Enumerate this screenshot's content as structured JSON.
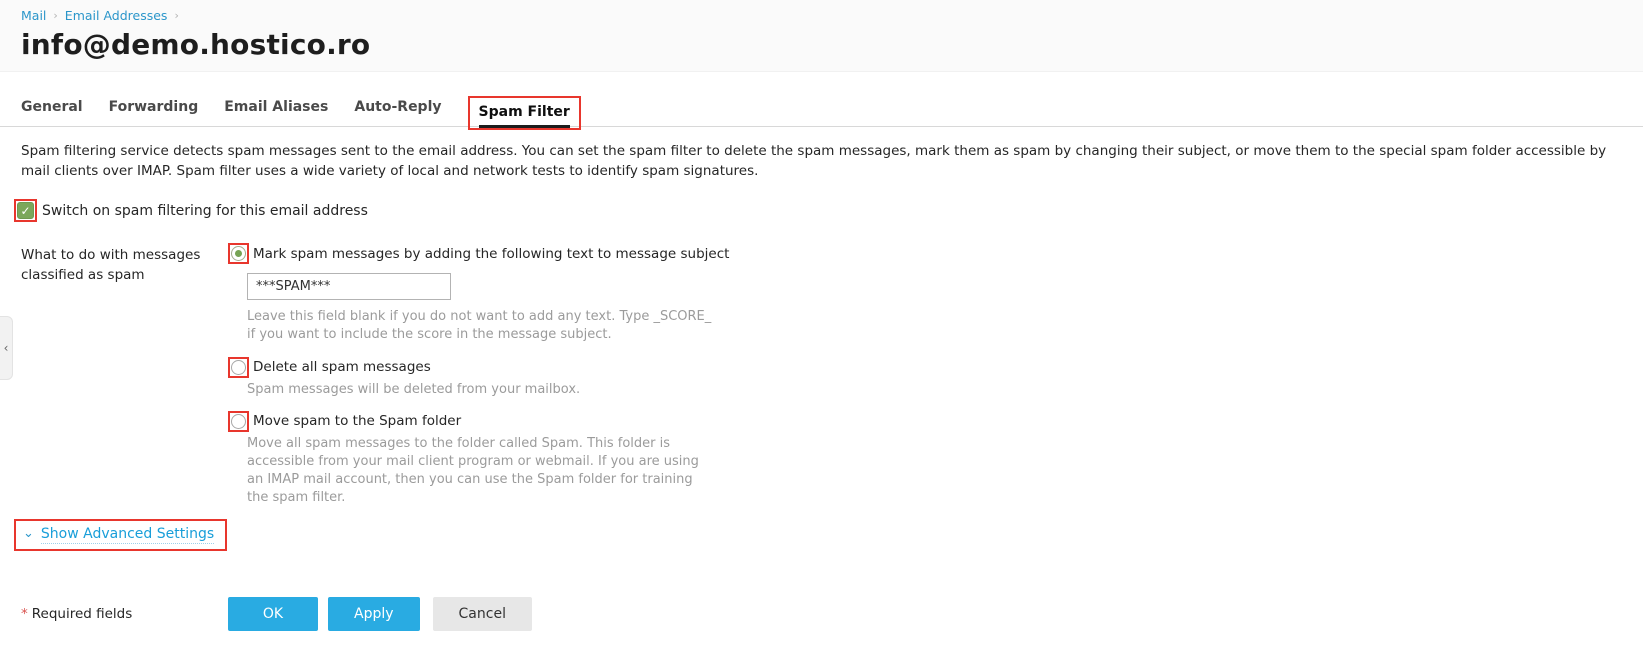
{
  "page_title": "info@demo.hostico.ro",
  "breadcrumb": {
    "separator": "›",
    "items": [
      {
        "label": "Mail"
      },
      {
        "label": "Email Addresses"
      }
    ]
  },
  "tabs": {
    "active": "Spam Filter",
    "items": [
      {
        "label": "General"
      },
      {
        "label": "Forwarding"
      },
      {
        "label": "Email Aliases"
      },
      {
        "label": "Auto-Reply"
      },
      {
        "label": "Spam Filter"
      }
    ]
  },
  "description": "Spam filtering service detects spam messages sent to the email address. You can set the spam filter to delete the spam messages, mark them as spam by changing their subject, or move them to the special spam folder accessible by mail clients over IMAP. Spam filter uses a wide variety of local and network tests to identify spam signatures.",
  "spam_switch": {
    "label": "Switch on spam filtering for this email address",
    "checked": true
  },
  "classification": {
    "label": "What to do with messages classified as spam",
    "options": [
      {
        "label": "Mark spam messages by adding the following text to message subject",
        "selected": true,
        "input_value": "***SPAM***",
        "help": "Leave this field blank if you do not want to add any text. Type _SCORE_ if you want to include the score in the message subject."
      },
      {
        "label": "Delete all spam messages",
        "selected": false,
        "help": "Spam messages will be deleted from your mailbox."
      },
      {
        "label": "Move spam to the Spam folder",
        "selected": false,
        "help": "Move all spam messages to the folder called Spam. This folder is accessible from your mail client program or webmail. If you are using an IMAP mail account, then you can use the Spam folder for training the spam filter."
      }
    ]
  },
  "advanced": {
    "label": "Show Advanced Settings"
  },
  "footer": {
    "asterisk": "*",
    "required_note": "Required fields",
    "buttons": [
      {
        "label": "OK",
        "style": "primary"
      },
      {
        "label": "Apply",
        "style": "primary"
      },
      {
        "label": "Cancel",
        "style": "secondary"
      }
    ]
  },
  "icons": {
    "check": "✓",
    "chevron_down": "⌄",
    "chevron_left": "‹"
  },
  "colors": {
    "accent_blue": "#29abe2",
    "link_blue": "#2b96ca",
    "annotation_red": "#e8362d",
    "checkbox_green": "#7ba75b",
    "active_tab_underline": "#1c1c1c",
    "help_gray": "#9b9b9b"
  }
}
